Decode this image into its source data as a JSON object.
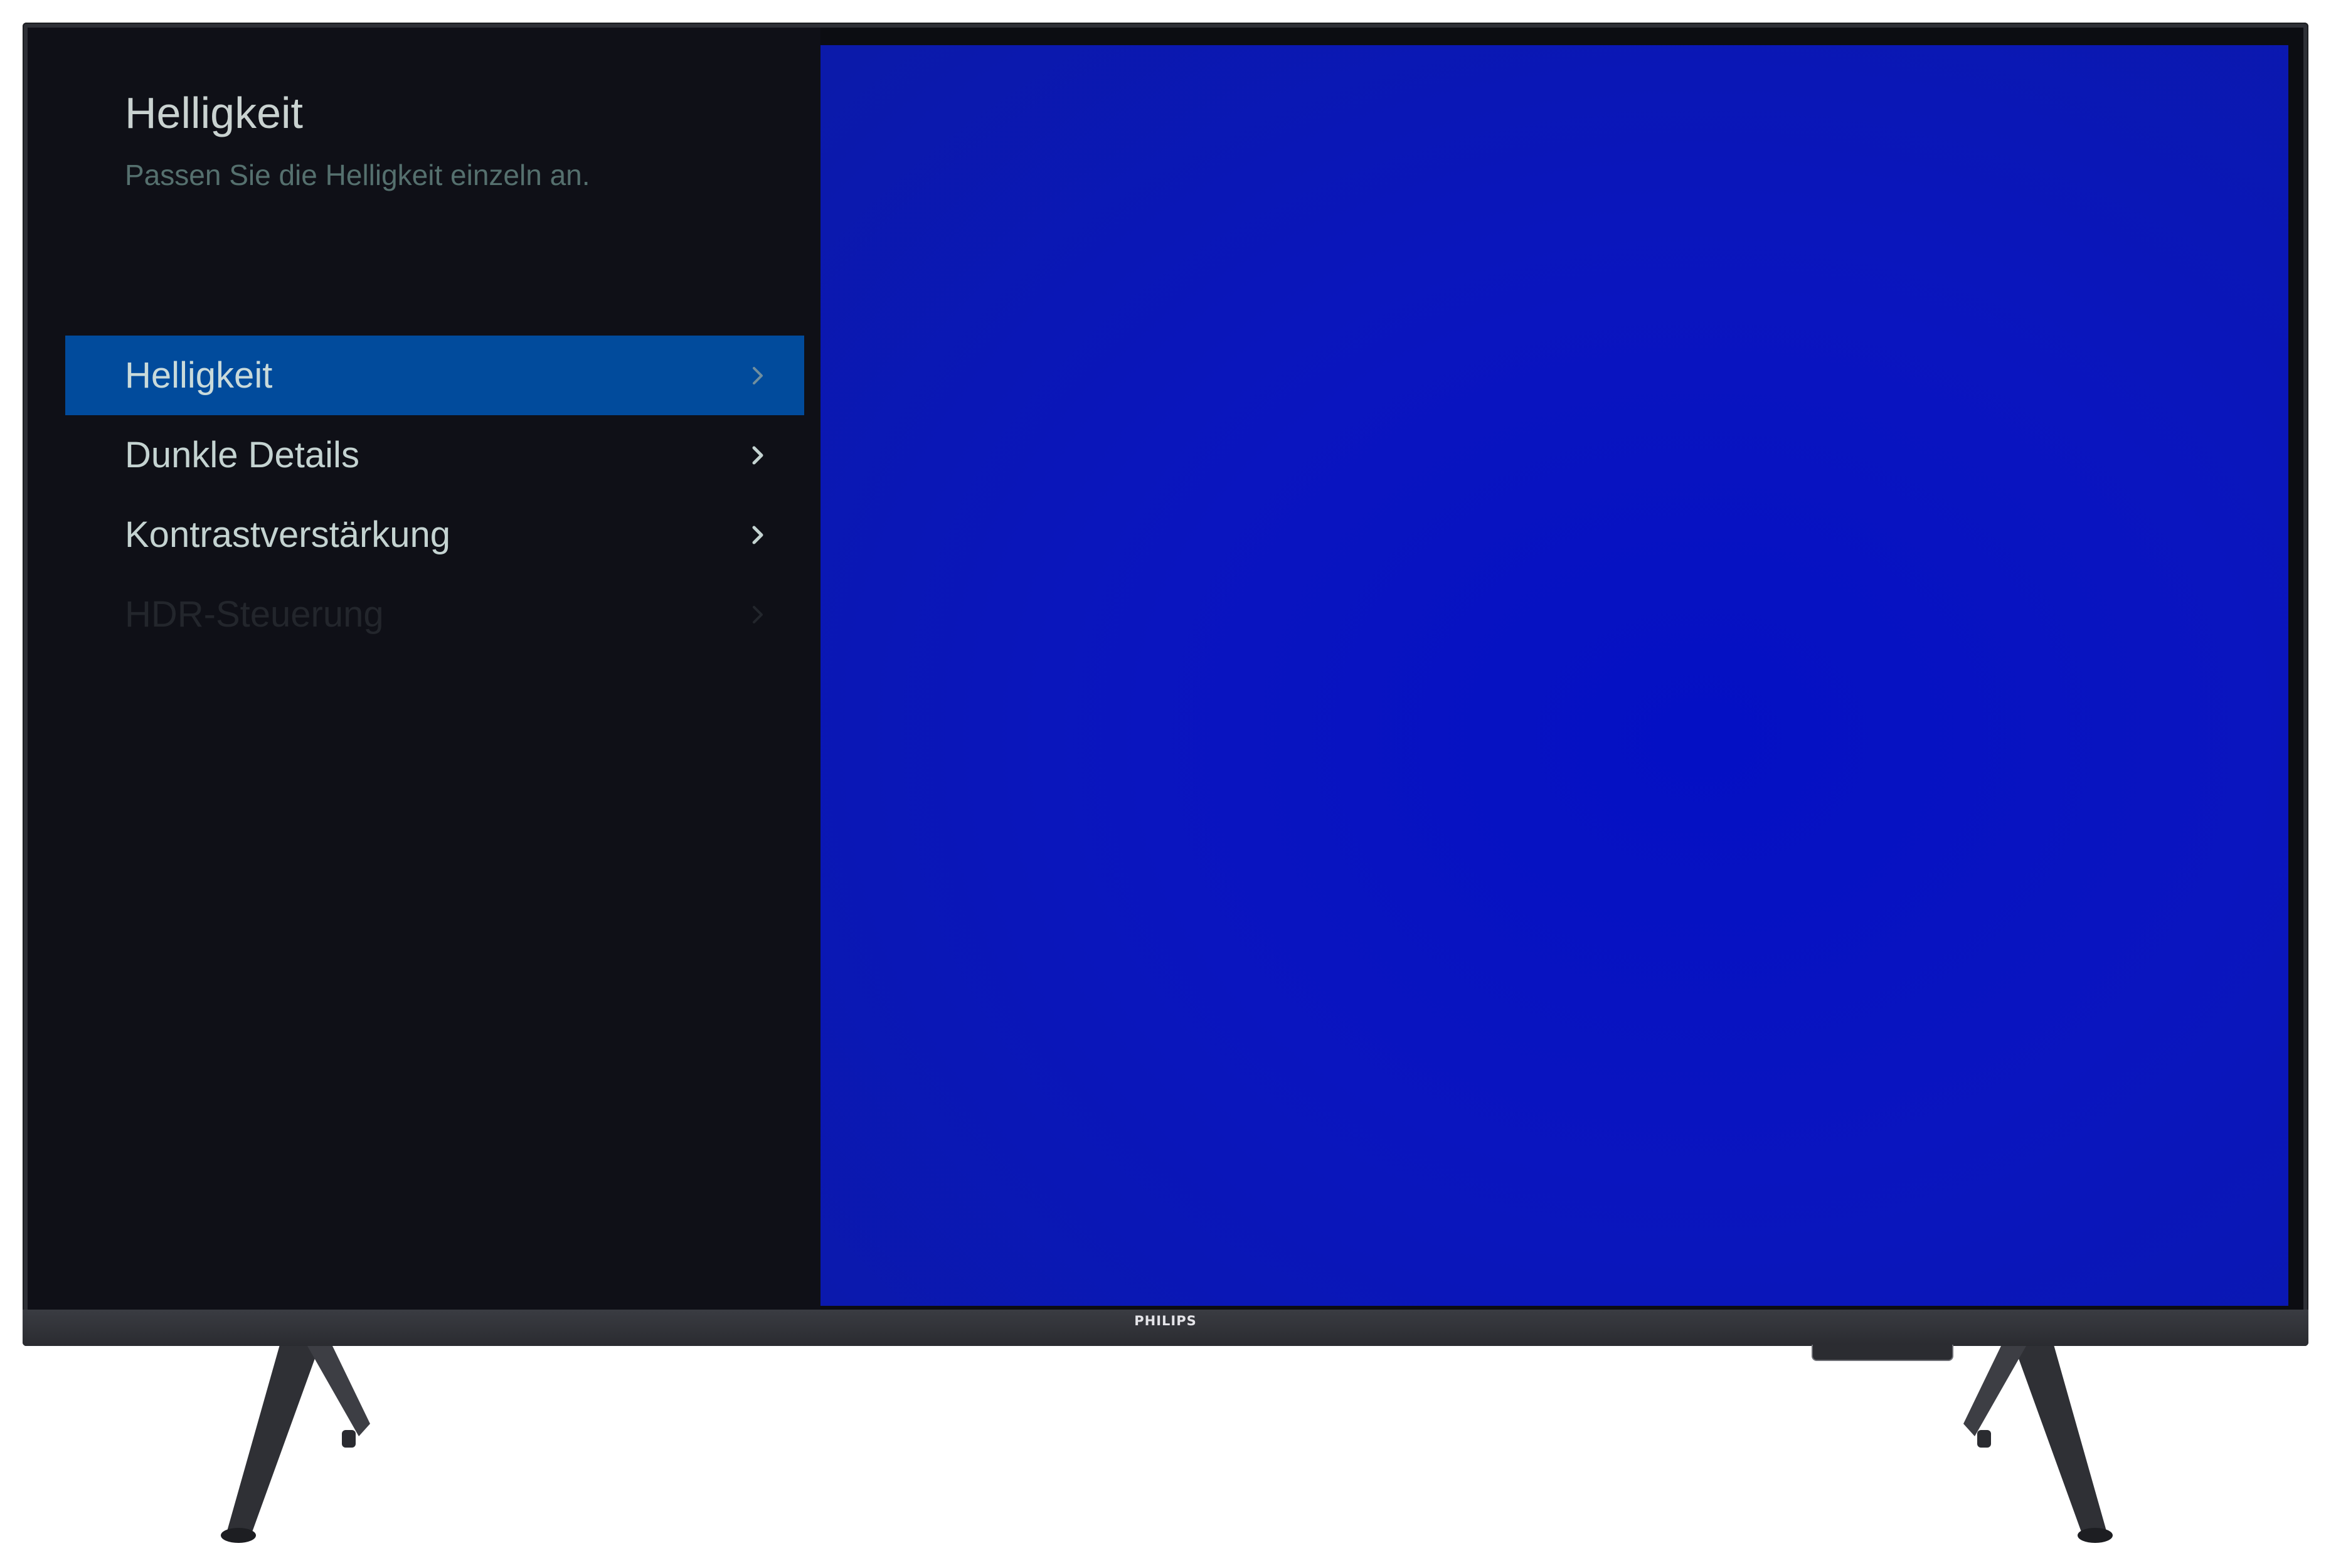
{
  "device": {
    "brand": "PHILIPS"
  },
  "menu": {
    "title": "Helligkeit",
    "subtitle": "Passen Sie die Helligkeit einzeln an.",
    "items": [
      {
        "label": "Helligkeit",
        "state": "selected"
      },
      {
        "label": "Dunkle Details",
        "state": "normal"
      },
      {
        "label": "Kontrastverstärkung",
        "state": "normal"
      },
      {
        "label": "HDR-Steuerung",
        "state": "disabled"
      }
    ]
  },
  "colors": {
    "selected_highlight": "#014b9c",
    "preview_blue": "#0410c4",
    "panel_background": "#0f1017"
  },
  "icons": {
    "menu_item_arrow": "chevron-right-icon"
  }
}
